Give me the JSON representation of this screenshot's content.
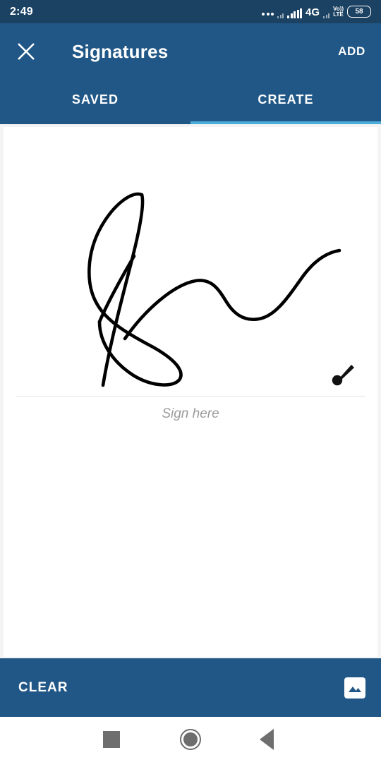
{
  "status_bar": {
    "clock": "2:49",
    "network_type": "4G",
    "volte_top": "Vo))",
    "volte_bottom": "LTE",
    "battery_level": "58",
    "icons": [
      "more-dots-icon",
      "signal-bars-icon",
      "signal-bars-secondary-icon",
      "volte-icon",
      "battery-icon"
    ]
  },
  "app_bar": {
    "close_icon": "close-icon",
    "title": "Signatures",
    "action_label": "ADD"
  },
  "tabs": {
    "items": [
      {
        "label": "SAVED",
        "active": false
      },
      {
        "label": "CREATE",
        "active": true
      }
    ],
    "indicator_color": "#4dadda"
  },
  "canvas": {
    "hint_text": "Sign here",
    "brush_icon": "brush-icon",
    "has_signature": true,
    "stroke_color": "#000000",
    "background_color": "#ffffff"
  },
  "bottom_bar": {
    "clear_label": "CLEAR",
    "gallery_icon": "image-icon",
    "background_color": "#215787"
  },
  "nav_bar": {
    "recents_icon": "square-recents-icon",
    "home_icon": "circle-home-icon",
    "back_icon": "triangle-back-icon"
  },
  "theme": {
    "status_bar_color": "#1b4263",
    "app_bar_color": "#215787",
    "accent_color": "#4dadda",
    "hint_color": "#9b9b9b"
  }
}
